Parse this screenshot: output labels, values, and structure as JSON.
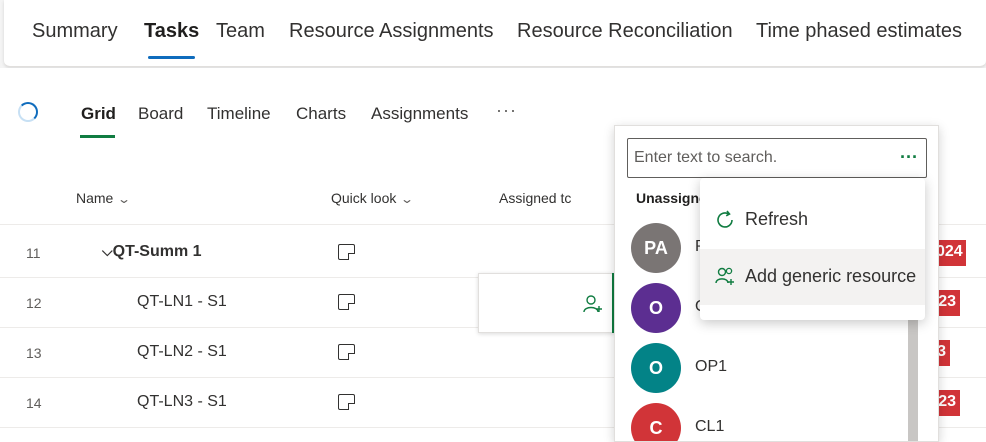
{
  "top_tabs": [
    {
      "label": "Summary"
    },
    {
      "label": "Tasks"
    },
    {
      "label": "Team"
    },
    {
      "label": "Resource Assignments"
    },
    {
      "label": "Resource Reconciliation"
    },
    {
      "label": "Time phased estimates"
    }
  ],
  "active_top_tab": "Tasks",
  "view_tabs": [
    {
      "label": "Grid"
    },
    {
      "label": "Board"
    },
    {
      "label": "Timeline"
    },
    {
      "label": "Charts"
    },
    {
      "label": "Assignments"
    }
  ],
  "active_view_tab": "Grid",
  "more_label": "···",
  "columns": {
    "name": "Name",
    "quick_look": "Quick look",
    "assigned_to": "Assigned tc"
  },
  "rows": [
    {
      "num": "11",
      "name": "QT-Summ 1",
      "summary": true,
      "badge": "024"
    },
    {
      "num": "12",
      "name": "QT-LN1 - S1",
      "summary": false,
      "badge": "23"
    },
    {
      "num": "13",
      "name": "QT-LN2 - S1",
      "summary": false,
      "badge": "3"
    },
    {
      "num": "14",
      "name": "QT-LN3 - S1",
      "summary": false,
      "badge": "23"
    }
  ],
  "resource_picker": {
    "search_placeholder": "Enter text to search.",
    "more_label": "···",
    "section_label": "Unassigned",
    "people": [
      {
        "initials": "PA",
        "name": "PA",
        "color": "#7a7574"
      },
      {
        "initials": "O",
        "name": "O",
        "color": "#5c2e91"
      },
      {
        "initials": "O",
        "name": "OP1",
        "color": "#038387"
      },
      {
        "initials": "C",
        "name": "CL1",
        "color": "#d13438"
      }
    ]
  },
  "context_menu": {
    "refresh_label": "Refresh",
    "add_generic_label": "Add generic resource"
  },
  "colors": {
    "accent_blue": "#0f6cbd",
    "accent_green": "#107c41",
    "badge_red": "#d13438"
  }
}
